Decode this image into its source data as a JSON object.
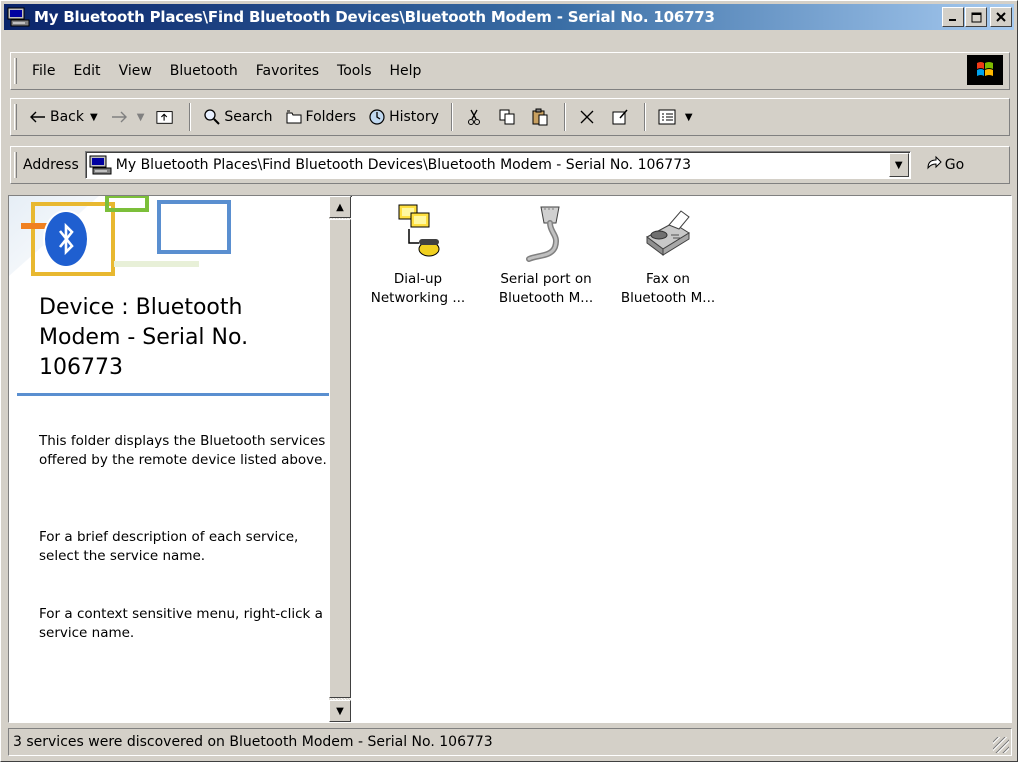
{
  "window": {
    "title": "My Bluetooth Places\\Find Bluetooth Devices\\Bluetooth Modem - Serial No. 106773",
    "minimize_label": "_",
    "maximize_label": "□",
    "close_label": "×"
  },
  "menubar": {
    "items": [
      {
        "label": "File"
      },
      {
        "label": "Edit"
      },
      {
        "label": "View"
      },
      {
        "label": "Bluetooth"
      },
      {
        "label": "Favorites"
      },
      {
        "label": "Tools"
      },
      {
        "label": "Help"
      }
    ]
  },
  "toolbar": {
    "back_label": "Back",
    "search_label": "Search",
    "folders_label": "Folders",
    "history_label": "History"
  },
  "address": {
    "label": "Address",
    "value": "My Bluetooth Places\\Find Bluetooth Devices\\Bluetooth Modem - Serial No. 106773",
    "go_label": "Go"
  },
  "left_pane": {
    "device_title": "Device : Bluetooth Modem - Serial No. 106773",
    "paragraphs": [
      "This folder displays the Bluetooth services offered by the remote device listed above.",
      "For a brief description of each service, select the service name.",
      "For a context sensitive menu, right-click a service name."
    ]
  },
  "services": [
    {
      "line1": "Dial-up",
      "line2": "Networking ...",
      "icon": "dialup-networking-icon"
    },
    {
      "line1": "Serial port on",
      "line2": "Bluetooth M...",
      "icon": "serial-port-icon"
    },
    {
      "line1": "Fax on",
      "line2": "Bluetooth M...",
      "icon": "fax-icon"
    }
  ],
  "statusbar": {
    "text": "3 services were discovered on Bluetooth Modem - Serial No. 106773"
  },
  "colors": {
    "titlebar_start": "#0a246a",
    "titlebar_end": "#a6caf0",
    "window_face": "#d4d0c8",
    "bluetooth_blue": "#1f5fd0",
    "pane_rule": "#5a8fd0"
  }
}
